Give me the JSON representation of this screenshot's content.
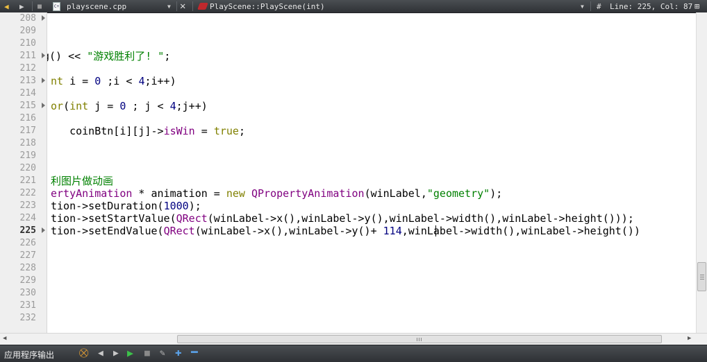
{
  "toolbar": {
    "back_icon": "arrow-left-icon",
    "forward_icon": "arrow-right-icon",
    "file_name": "playscene.cpp",
    "symbol": "PlayScene::PlayScene(int)",
    "hash": "#",
    "position": "Line: 225, Col: 87"
  },
  "editor": {
    "line_numbers": [
      "208",
      "209",
      "210",
      "211",
      "212",
      "213",
      "214",
      "215",
      "216",
      "217",
      "218",
      "219",
      "220",
      "221",
      "222",
      "223",
      "224",
      "225",
      "226",
      "227",
      "228",
      "229",
      "230",
      "231",
      "232"
    ],
    "current_line": "225",
    "code": {
      "l211": {
        "a": "g() << ",
        "b": "\"游戏胜利了! \"",
        "c": ";"
      },
      "l213": {
        "a": "nt",
        "b": " i = ",
        "c": "0",
        "d": " ;i < ",
        "e": "4",
        "f": ";i++)"
      },
      "l215": {
        "a": "or",
        "b": "(",
        "c": "int",
        "d": " j = ",
        "e": "0",
        "f": " ; j < ",
        "g": "4",
        "h": ";j++)"
      },
      "l217": {
        "a": "   coinBtn[i][j]->",
        "b": "isWin",
        "c": " = ",
        "d": "true",
        "e": ";"
      },
      "l221": {
        "a": "利图片做动画"
      },
      "l222": {
        "a": "ertyAnimation",
        "b": " * animation = ",
        "c": "new",
        "d": " ",
        "e": "QPropertyAnimation",
        "f": "(winLabel,",
        "g": "\"geometry\"",
        "h": ");"
      },
      "l223": {
        "a": "tion->setDuration(",
        "b": "1000",
        "c": ");"
      },
      "l224": {
        "a": "tion->setStartValue(",
        "b": "QRect",
        "c": "(winLabel->x(),winLabel->y(),winLabel->width(),winLabel->height()));"
      },
      "l225": {
        "a": "tion->setEndValue(",
        "b": "QRect",
        "c": "(winLabel->x(),winLabel->y()+ ",
        "d": "114",
        "e": ",winLabel->width(),winLabel->height())"
      }
    }
  },
  "output_pane": {
    "label": "应用程序输出"
  },
  "colors": {
    "keyword": "#808000",
    "type": "#800080",
    "string": "#008000",
    "number": "#000080",
    "comment": "#008000",
    "toolbar_bg": "#3a3d41"
  }
}
